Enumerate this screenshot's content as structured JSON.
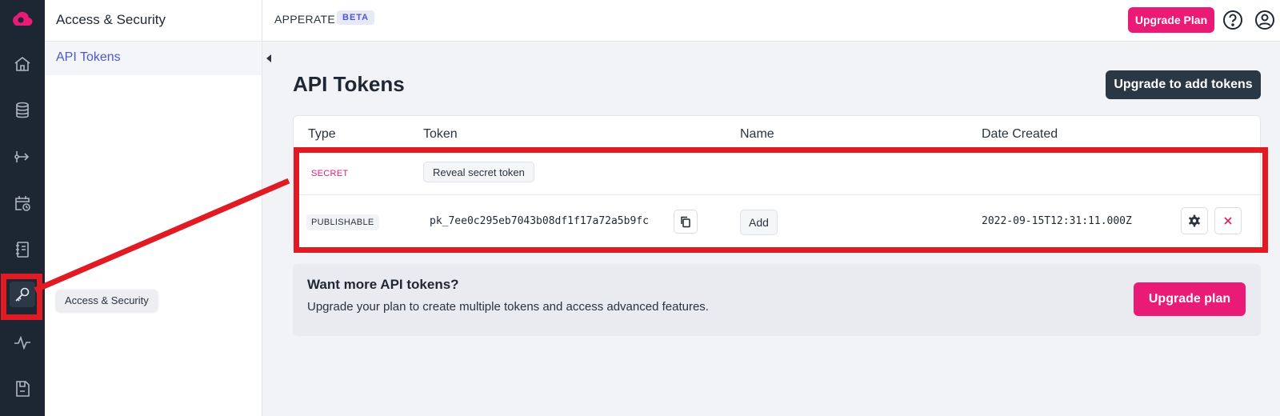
{
  "colors": {
    "rail": "#1c2733",
    "accent": "#ea1a77",
    "link": "#4a57d6",
    "annotation": "#e01b24"
  },
  "rail": {
    "icons": [
      "cloud-logo-icon",
      "home-icon",
      "database-icon",
      "route-icon",
      "calendar-clock-icon",
      "notebook-icon",
      "key-icon",
      "activity-icon",
      "save-icon"
    ],
    "active": "key-icon"
  },
  "subnav": {
    "title": "Access & Security",
    "items": [
      {
        "label": "API Tokens",
        "active": true
      }
    ]
  },
  "tooltip": "Access & Security",
  "topbar": {
    "brand": "APPERATE",
    "badge": "BETA",
    "upgrade_label": "Upgrade Plan",
    "icons": [
      "help-icon",
      "account-icon"
    ]
  },
  "main": {
    "title": "API Tokens",
    "upgrade_tokens_label": "Upgrade to add tokens",
    "table": {
      "headers": [
        "Type",
        "Token",
        "Name",
        "Date Created"
      ],
      "rows": [
        {
          "type": "SECRET",
          "token_action": "Reveal secret token"
        },
        {
          "type": "PUBLISHABLE",
          "token": "pk_7ee0c295eb7043b08df1f17a72a5b9fc",
          "name_action": "Add",
          "date": "2022-09-15T12:31:11.000Z"
        }
      ]
    },
    "promo": {
      "title": "Want more API tokens?",
      "body": "Upgrade your plan to create multiple tokens and access advanced features.",
      "button": "Upgrade plan"
    }
  }
}
